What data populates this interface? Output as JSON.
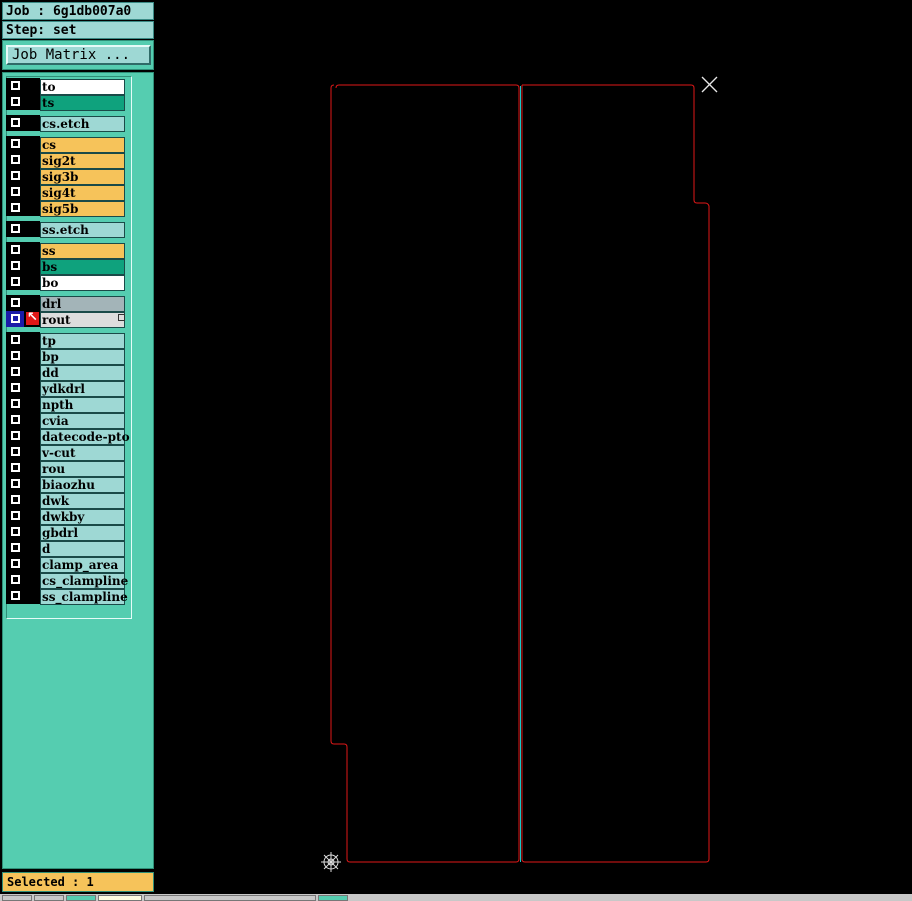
{
  "header": {
    "job_label": "Job : 6g1db007a0",
    "step_label": "Step: set",
    "matrix_button": "Job Matrix ..."
  },
  "layers": [
    {
      "name": "to",
      "color": "#ffffff"
    },
    {
      "name": "ts",
      "color": "#0fa27d"
    },
    {
      "name": "cs.etch",
      "color": "#9ed8d4"
    },
    {
      "name": "cs",
      "color": "#f6c35a"
    },
    {
      "name": "sig2t",
      "color": "#f6c35a"
    },
    {
      "name": "sig3b",
      "color": "#f6c35a"
    },
    {
      "name": "sig4t",
      "color": "#f6c35a"
    },
    {
      "name": "sig5b",
      "color": "#f6c35a"
    },
    {
      "name": "ss.etch",
      "color": "#9ed8d4"
    },
    {
      "name": "ss",
      "color": "#f6c35a"
    },
    {
      "name": "bs",
      "color": "#0fa27d"
    },
    {
      "name": "bo",
      "color": "#ffffff"
    },
    {
      "name": "drl",
      "color": "#a3b4b8"
    },
    {
      "name": "rout",
      "color": "#dddddd",
      "active": true
    },
    {
      "name": "tp",
      "color": "#9ed8d4"
    },
    {
      "name": "bp",
      "color": "#9ed8d4"
    },
    {
      "name": "dd",
      "color": "#9ed8d4"
    },
    {
      "name": "ydkdrl",
      "color": "#9ed8d4"
    },
    {
      "name": "npth",
      "color": "#9ed8d4"
    },
    {
      "name": "cvia",
      "color": "#9ed8d4"
    },
    {
      "name": "datecode-pto",
      "color": "#9ed8d4"
    },
    {
      "name": "v-cut",
      "color": "#9ed8d4"
    },
    {
      "name": "rou",
      "color": "#9ed8d4"
    },
    {
      "name": "biaozhu",
      "color": "#9ed8d4"
    },
    {
      "name": "dwk",
      "color": "#9ed8d4"
    },
    {
      "name": "dwkby",
      "color": "#9ed8d4"
    },
    {
      "name": "gbdrl",
      "color": "#9ed8d4"
    },
    {
      "name": "d",
      "color": "#9ed8d4"
    },
    {
      "name": "clamp_area",
      "color": "#9ed8d4"
    },
    {
      "name": "cs_clampline",
      "color": "#9ed8d4"
    },
    {
      "name": "ss_clampline",
      "color": "#9ed8d4"
    }
  ],
  "status": {
    "selected_label": "Selected : 1"
  },
  "colors": {
    "panel_bg": "#55cdb0",
    "outline": "#e01818",
    "center_line": "#19c7c7",
    "header_bg": "#9ed8d4",
    "status_bg": "#f6c35a"
  },
  "icons": {
    "datum": "crosshair-icon",
    "cursor": "x-cursor-icon"
  }
}
